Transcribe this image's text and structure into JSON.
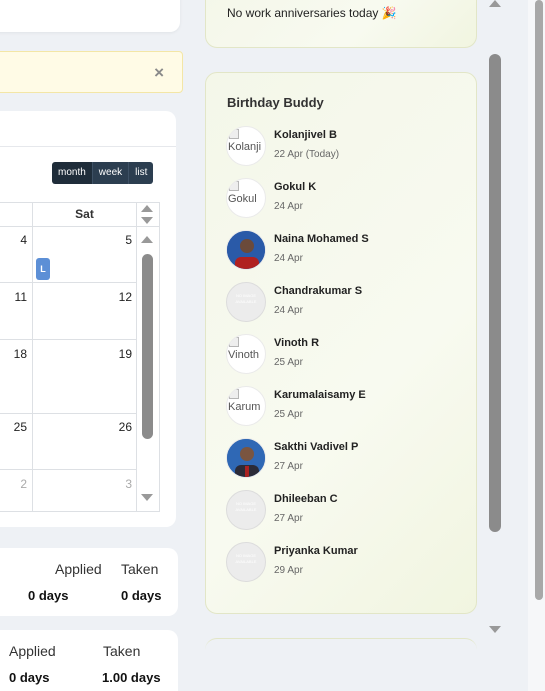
{
  "alert": {
    "close_icon": "×"
  },
  "calendar": {
    "views": [
      "month",
      "week",
      "list"
    ],
    "active_view": "month",
    "weekday_header": "Sat",
    "rows": [
      {
        "left": "4",
        "right": "5"
      },
      {
        "left": "11",
        "right": "12"
      },
      {
        "left": "18",
        "right": "19"
      },
      {
        "left": "25",
        "right": "26"
      },
      {
        "left": "2",
        "right": "3"
      }
    ],
    "event_label": "L"
  },
  "leave_summaries": [
    {
      "applied_label": "Applied",
      "applied_value": "0 days",
      "taken_label": "Taken",
      "taken_value": "0 days"
    },
    {
      "applied_label": "Applied",
      "applied_value": "0 days",
      "taken_label": "Taken",
      "taken_value": "1.00 days"
    }
  ],
  "anniversaries": {
    "empty_text": "No work anniversaries today 🎉"
  },
  "birthday_buddy": {
    "title": "Birthday Buddy",
    "people": [
      {
        "name": "Kolanjivel B",
        "date": "22 Apr (Today)",
        "avatar_alt": "Kolanji",
        "avatar": "broken"
      },
      {
        "name": "Gokul K",
        "date": "24 Apr",
        "avatar_alt": "Gokul",
        "avatar": "broken"
      },
      {
        "name": "Naina Mohamed S",
        "date": "24 Apr",
        "avatar": "photo"
      },
      {
        "name": "Chandrakumar S",
        "date": "24 Apr",
        "avatar": "no-image"
      },
      {
        "name": "Vinoth R",
        "date": "25 Apr",
        "avatar_alt": "Vinoth",
        "avatar": "broken"
      },
      {
        "name": "Karumalaisamy E",
        "date": "25 Apr",
        "avatar_alt": "Karum",
        "avatar": "broken"
      },
      {
        "name": "Sakthi Vadivel P",
        "date": "27 Apr",
        "avatar": "photo"
      },
      {
        "name": "Dhileeban C",
        "date": "27 Apr",
        "avatar": "no-image"
      },
      {
        "name": "Priyanka Kumar",
        "date": "29 Apr",
        "avatar": "no-image"
      }
    ],
    "no_image_text": "NO IMAGE AVAILABLE"
  },
  "colors": {
    "accent": "#2c3e50",
    "event": "#5c8fd6",
    "panel_bg": "#f4f7e9"
  }
}
